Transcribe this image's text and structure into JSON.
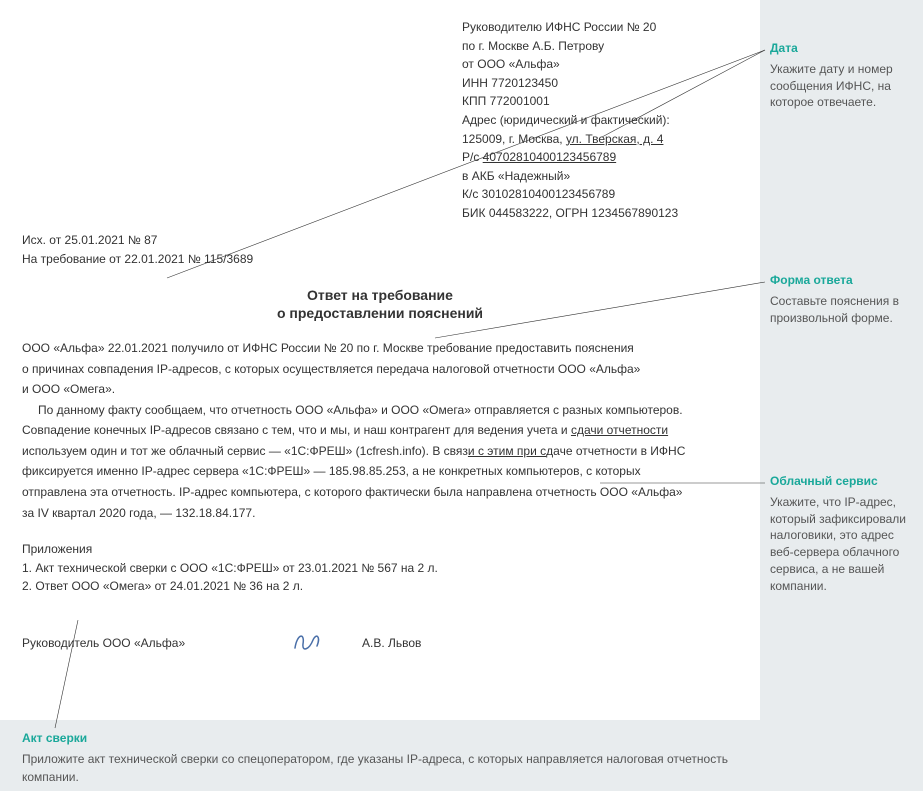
{
  "header": {
    "line1": "Руководителю ИФНС России № 20",
    "line2": "по г. Москве А.Б. Петрову",
    "line3": "от ООО «Альфа»",
    "line4": "ИНН 7720123450",
    "line5": "КПП 772001001",
    "line6": "Адрес (юридический и фактический):",
    "line7a": "125009, г. Москва, ",
    "line7b": "ул. Тверская, д. 4",
    "line8a": "Р/с ",
    "line8b": "40702810400123456789",
    "line9": "в АКБ «Надежный»",
    "line10": "К/с 30102810400123456789",
    "line11": "БИК 044583222, ОГРН 1234567890123"
  },
  "meta": {
    "outgoing": "Исх. от 25.01.2021 № 87",
    "request": "На требование от 22.01.2021 № 115/3689"
  },
  "title": {
    "line1": "Ответ на требование",
    "line2": "о предоставлении пояснений"
  },
  "body": {
    "p1a": "ООО «Альфа» 22.01.2021 получило от ИФНС России № 20 по г. Москве требование предоставить пояснения",
    "p1b": "о причинах совпадения IP-адресов, с которых осуществляется передача налоговой отчетности ООО «Альфа»",
    "p1c": "и ООО «Омега».",
    "p2a": "По данному факту сообщаем, что отчетность ООО «Альфа» и ООО «Омега» отправляется с разных компьютеров.",
    "p2b_pre": "Совпадение конечных IP-адресов связано с тем, что и мы, и наш контрагент для ведения учета и ",
    "p2b_u": "сдачи отчетности",
    "p2c_pre": "используем один и тот же облачный сервис — «1С:ФРЕШ» (1cfresh.info). В связ",
    "p2c_u": "и с этим при с",
    "p2c_post": "даче отчетности в ИФНС",
    "p2d": "фиксируется именно IP-адрес сервера «1С:ФРЕШ» — 185.98.85.253, а не конкретных компьютеров, с которых",
    "p2e": "отправлена эта отчетность. IP-адрес компьютера, с которого фактически была направлена отчетность ООО «Альфа»",
    "p2f": "за IV квартал 2020 года, — 132.18.84.177."
  },
  "attachments": {
    "heading": "Приложения",
    "item1": "1. Акт технической сверки с ООО «1С:ФРЕШ» от 23.01.2021 № 567 на 2 л.",
    "item2": "2. Ответ ООО «Омега» от 24.01.2021 № 36 на 2 л."
  },
  "signature": {
    "title": "Руководитель ООО «Альфа»",
    "name": "А.В. Львов"
  },
  "annotations": {
    "date": {
      "title": "Дата",
      "text": "Укажите дату и номер сообщения ИФНС, на которое отвечаете."
    },
    "form": {
      "title": "Форма ответа",
      "text": "Составьте пояснения в произвольной форме."
    },
    "cloud": {
      "title": "Облачный сервис",
      "text": "Укажите, что IP-адрес, который зафиксировали налоговики, это адрес веб-сервера облачного сервиса, а не вашей компании."
    },
    "act": {
      "title": "Акт сверки",
      "text": "Приложите акт технической сверки со спецоператором, где указаны IP-адреса, с которых направляется налоговая отчетность компании."
    }
  }
}
